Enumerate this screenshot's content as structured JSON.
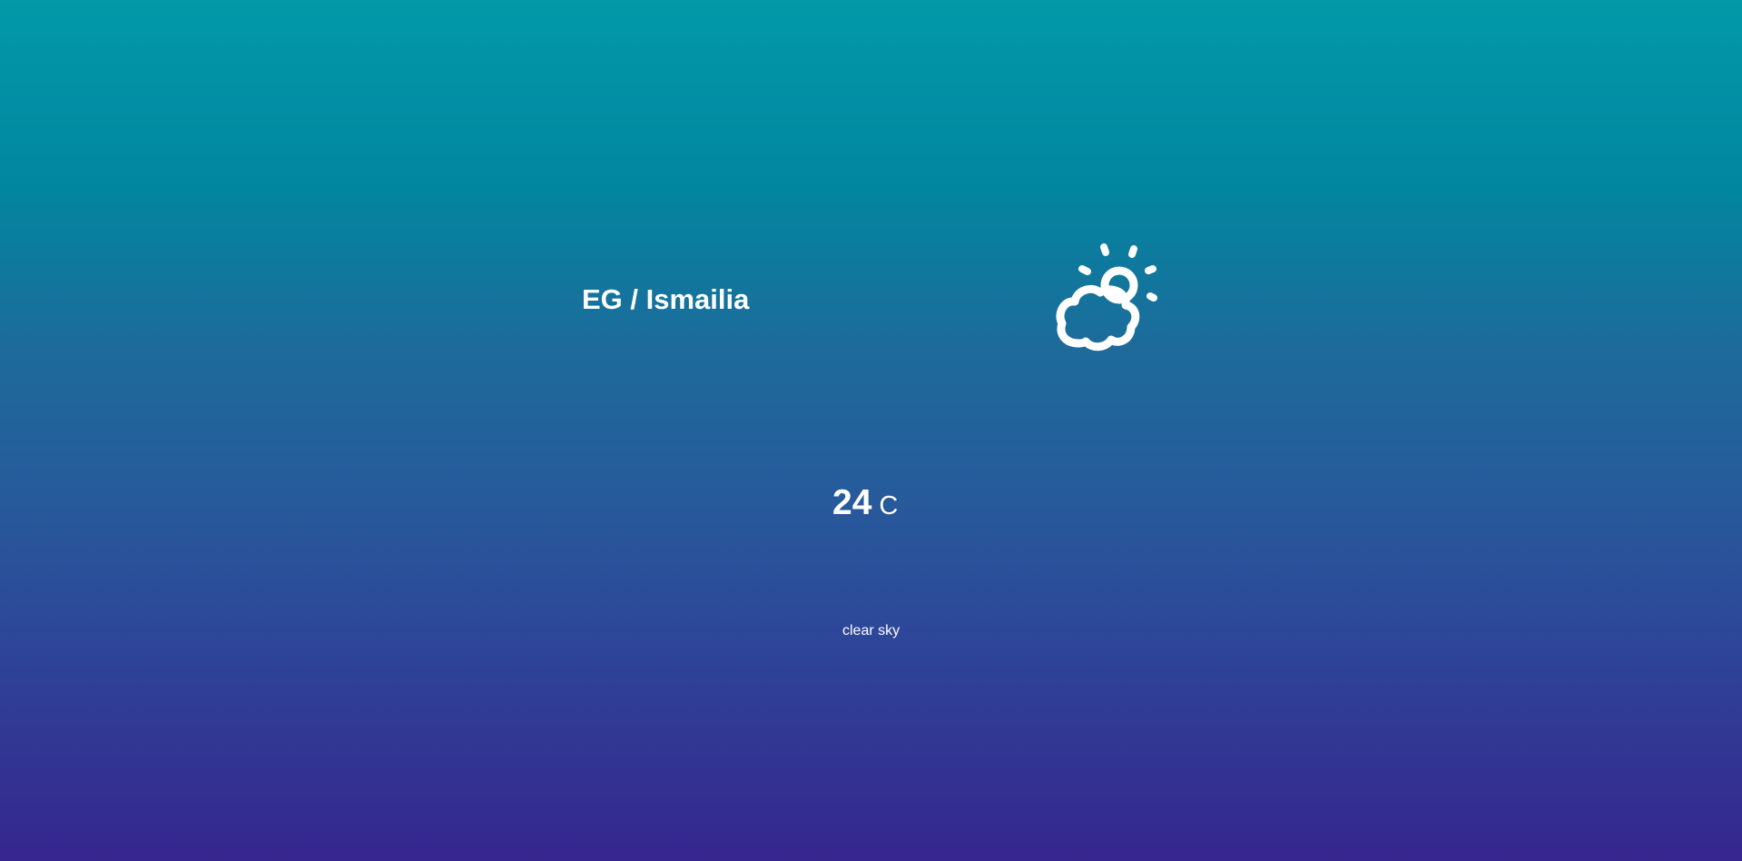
{
  "location": {
    "label": "EG / Ismailia"
  },
  "weather": {
    "icon": "partly-cloudy-icon",
    "temperature": "24",
    "unit": "C",
    "description": "clear sky"
  },
  "colors": {
    "gradient_top": "#0299a9",
    "gradient_bottom": "#36258e",
    "text": "#ffffff"
  }
}
